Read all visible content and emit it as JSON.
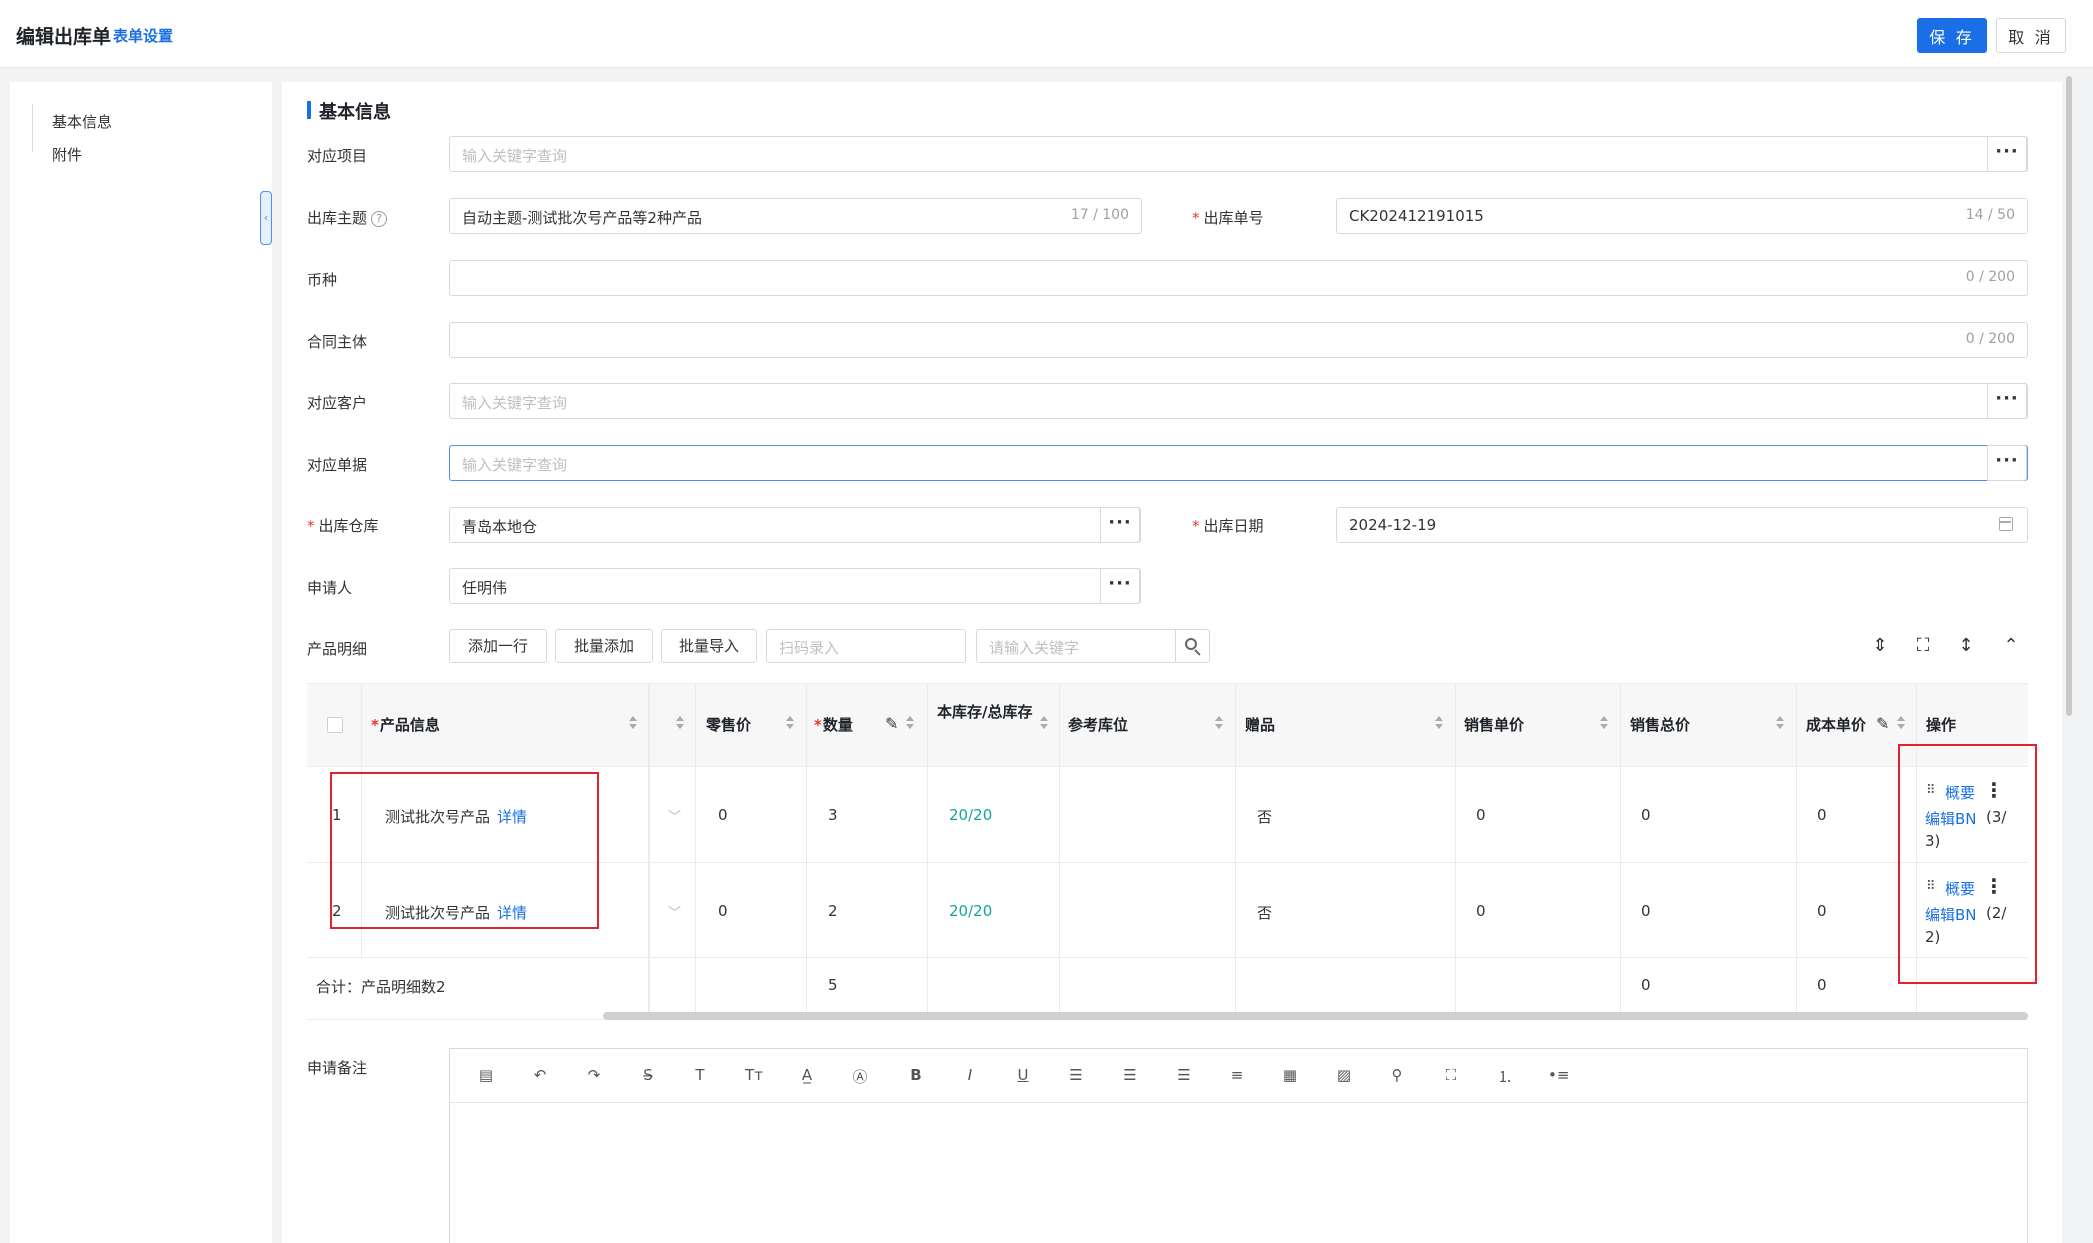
{
  "header": {
    "title": "编辑出库单",
    "form_settings": "表单设置",
    "save_label": "保 存",
    "cancel_label": "取 消"
  },
  "sidebar": {
    "items": [
      {
        "label": "基本信息"
      },
      {
        "label": "附件"
      }
    ],
    "collapse_icon": "chevron-left-icon"
  },
  "section": {
    "title": "基本信息"
  },
  "form": {
    "project": {
      "label": "对应项目",
      "placeholder": "输入关键字查询"
    },
    "subject": {
      "label": "出库主题",
      "value": "自动主题-测试批次号产品等2种产品",
      "count": "17 / 100"
    },
    "order_no": {
      "label": "出库单号",
      "value": "CK202412191015",
      "count": "14 / 50"
    },
    "currency": {
      "label": "币种",
      "count": "0 / 200"
    },
    "contract_entity": {
      "label": "合同主体",
      "count": "0 / 200"
    },
    "customer": {
      "label": "对应客户",
      "placeholder": "输入关键字查询"
    },
    "document": {
      "label": "对应单据",
      "placeholder": "输入关键字查询"
    },
    "warehouse": {
      "label": "出库仓库",
      "value": "青岛本地仓"
    },
    "date": {
      "label": "出库日期",
      "value": "2024-12-19"
    },
    "applicant": {
      "label": "申请人",
      "value": "任明伟"
    },
    "required_mark": "*",
    "help_mark": "?",
    "dots": "···"
  },
  "products": {
    "label": "产品明细",
    "add_row": "添加一行",
    "batch_add": "批量添加",
    "batch_import": "批量导入",
    "scan_placeholder": "扫码录入",
    "search_placeholder": "请输入关键字",
    "columns": {
      "product_info": "产品信息",
      "retail_price": "零售价",
      "quantity": "数量",
      "stock": "本库存/总库存",
      "location": "参考库位",
      "gift": "赠品",
      "sale_unit_price": "销售单价",
      "sale_total": "销售总价",
      "cost_unit_price": "成本单价",
      "actions": "操作"
    },
    "rows": [
      {
        "index": "1",
        "name": "测试批次号产品",
        "detail": "详情",
        "retail_price": "0",
        "quantity": "3",
        "stock_current": "20",
        "stock_total": "20",
        "gift": "否",
        "sale_unit_price": "0",
        "sale_total": "0",
        "cost_unit_price": "0",
        "summary_link": "概要",
        "edit_bn": "编辑BN",
        "bn_count_a": "(3/",
        "bn_count_b": "3)"
      },
      {
        "index": "2",
        "name": "测试批次号产品",
        "detail": "详情",
        "retail_price": "0",
        "quantity": "2",
        "stock_current": "20",
        "stock_total": "20",
        "gift": "否",
        "sale_unit_price": "0",
        "sale_total": "0",
        "cost_unit_price": "0",
        "summary_link": "概要",
        "edit_bn": "编辑BN",
        "bn_count_a": "(2/",
        "bn_count_b": "2)"
      }
    ],
    "total": {
      "label": "合计：产品明细数2",
      "quantity": "5",
      "sale_total": "0",
      "cost_unit_price": "0"
    }
  },
  "remarks": {
    "label": "申请备注"
  }
}
